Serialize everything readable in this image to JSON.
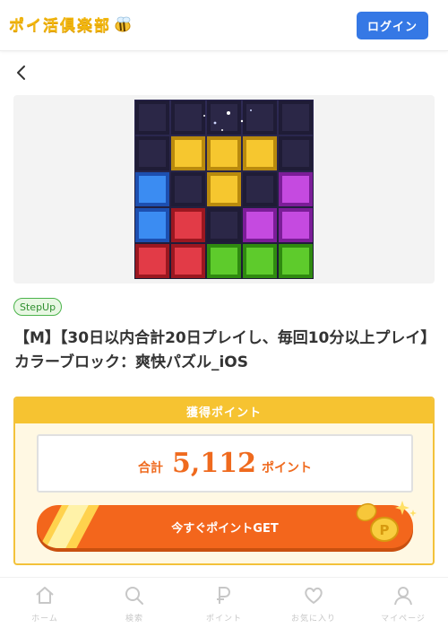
{
  "header": {
    "logo_text": "ポイ活俱楽部",
    "login_label": "ログイン",
    "accent": "#3578e5",
    "logo_color": "#f2b70f"
  },
  "offer": {
    "badge": "StepUp",
    "title": "【M】【30日以内合計20日プレイし、毎回10分以上プレイ】カラーブロック：爽快パズル_iOS"
  },
  "points": {
    "header": "獲得ポイント",
    "total_label": "合計",
    "value": "5,112",
    "unit": "ポイント",
    "cta_label": "今すぐポイントGET",
    "accent": "#ef6a1e"
  },
  "tabbar": {
    "items": [
      {
        "label": "ホーム",
        "icon": "home-icon"
      },
      {
        "label": "検索",
        "icon": "search-icon"
      },
      {
        "label": "ポイント",
        "icon": "point-icon"
      },
      {
        "label": "お気に入り",
        "icon": "heart-icon"
      },
      {
        "label": "マイページ",
        "icon": "user-icon"
      }
    ]
  }
}
